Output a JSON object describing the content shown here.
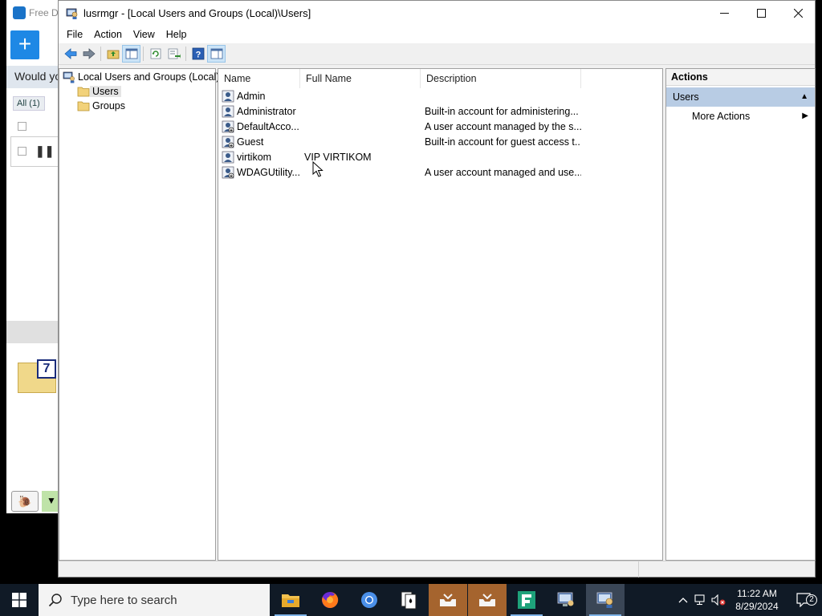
{
  "background_app": {
    "title": "Free D",
    "ask_text": "Would yo",
    "filter_label": "All (1)",
    "badge": "7"
  },
  "window": {
    "title": "lusrmgr - [Local Users and Groups (Local)\\Users]"
  },
  "menu": [
    "File",
    "Action",
    "View",
    "Help"
  ],
  "tree": {
    "root": "Local Users and Groups (Local)",
    "users": "Users",
    "groups": "Groups"
  },
  "list": {
    "columns": [
      "Name",
      "Full Name",
      "Description"
    ],
    "rows": [
      {
        "name": "Admin",
        "full_name": "",
        "description": ""
      },
      {
        "name": "Administrator",
        "full_name": "",
        "description": "Built-in account for administering..."
      },
      {
        "name": "DefaultAcco...",
        "full_name": "",
        "description": "A user account managed by the s..."
      },
      {
        "name": "Guest",
        "full_name": "",
        "description": "Built-in account for guest access t..."
      },
      {
        "name": "virtikom",
        "full_name": "VIP VIRTIKOM",
        "description": ""
      },
      {
        "name": "WDAGUtility...",
        "full_name": "",
        "description": "A user account managed and use..."
      }
    ]
  },
  "actions": {
    "header": "Actions",
    "section": "Users",
    "more": "More Actions"
  },
  "taskbar": {
    "search_placeholder": "Type here to search",
    "time": "11:22 AM",
    "date": "8/29/2024",
    "notification_count": "2"
  },
  "colors": {
    "taskbar_bg": "#101a26",
    "actions_section_bg": "#b8cce4",
    "accent_blue": "#1e88e5"
  }
}
